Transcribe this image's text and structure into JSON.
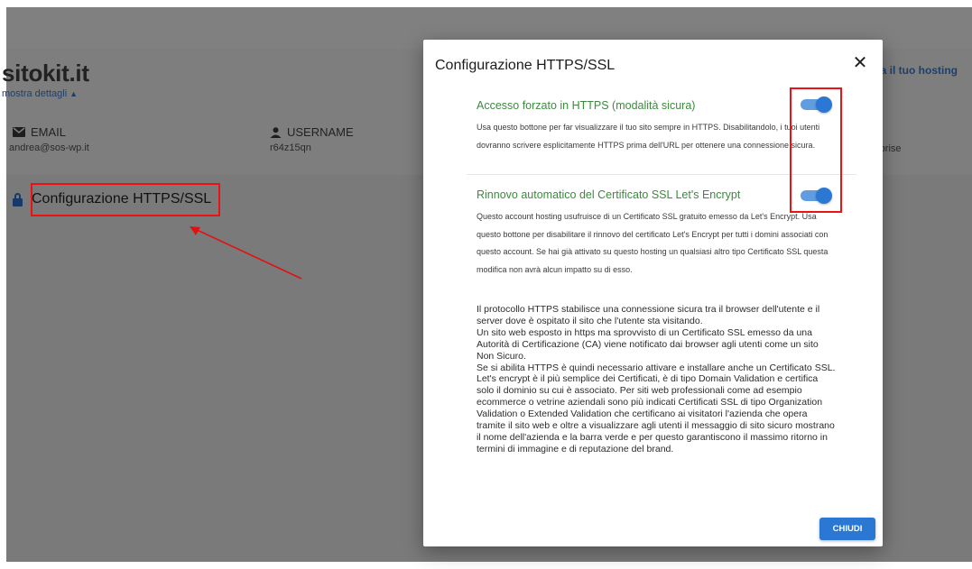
{
  "background": {
    "site_title": "sitokit.it",
    "details_link": "mostra dettagli",
    "email_label": "EMAIL",
    "email_value": "andrea@sos-wp.it",
    "username_label": "USERNAME",
    "username_value": "r64z15qn",
    "right_link": "ra il tuo hosting",
    "right_value": "rprise",
    "config_link": "Configurazione HTTPS/SSL"
  },
  "modal": {
    "title": "Configurazione HTTPS/SSL",
    "close_symbol": "✕",
    "sections": [
      {
        "title": "Accesso forzato in HTTPS (modalità sicura)",
        "description": "Usa questo bottone per far visualizzare il tuo sito sempre in HTTPS. Disabilitandolo, i tuoi utenti dovranno scrivere esplicitamente HTTPS prima dell'URL per ottenere una connessione sicura.",
        "enabled": true
      },
      {
        "title": "Rinnovo automatico del Certificato SSL Let's Encrypt",
        "description": "Questo account hosting usufruisce di un Certificato SSL gratuito emesso da Let's Encrypt. Usa questo bottone per disabilitare il rinnovo del certificato Let's Encrypt per tutti i domini associati con questo account. Se hai già attivato su questo hosting un qualsiasi altro tipo Certificato SSL questa modifica non avrà alcun impatto su di esso.",
        "enabled": true
      }
    ],
    "info_paragraphs": [
      "Il protocollo HTTPS stabilisce una connessione sicura tra il browser dell'utente e il server dove è ospitato il sito che l'utente sta visitando.",
      "Un sito web esposto in https ma sprovvisto di un Certificato SSL emesso da una Autorità di Certificazione (CA) viene notificato dai browser agli utenti come un sito Non Sicuro.",
      "Se si abilita HTTPS è quindi necessario attivare e installare anche un Certificato SSL.",
      "Let's encrypt è il più semplice dei Certificati, è di tipo Domain Validation e certifica solo il dominio su cui è associato. Per siti web professionali come ad esempio ecommerce o vetrine aziendali sono più indicati Certificati SSL di tipo Organization Validation o Extended Validation che certificano ai visitatori l'azienda che opera tramite il sito web e oltre a visualizzare agli utenti il messaggio di sito sicuro mostrano il nome dell'azienda e la barra verde e per questo garantiscono il massimo ritorno in termini di immagine e di reputazione del brand."
    ],
    "close_button": "CHIUDI"
  },
  "colors": {
    "accent": "#2a77d4",
    "section_title": "#3d8a3f",
    "annotation": "#e11111"
  }
}
